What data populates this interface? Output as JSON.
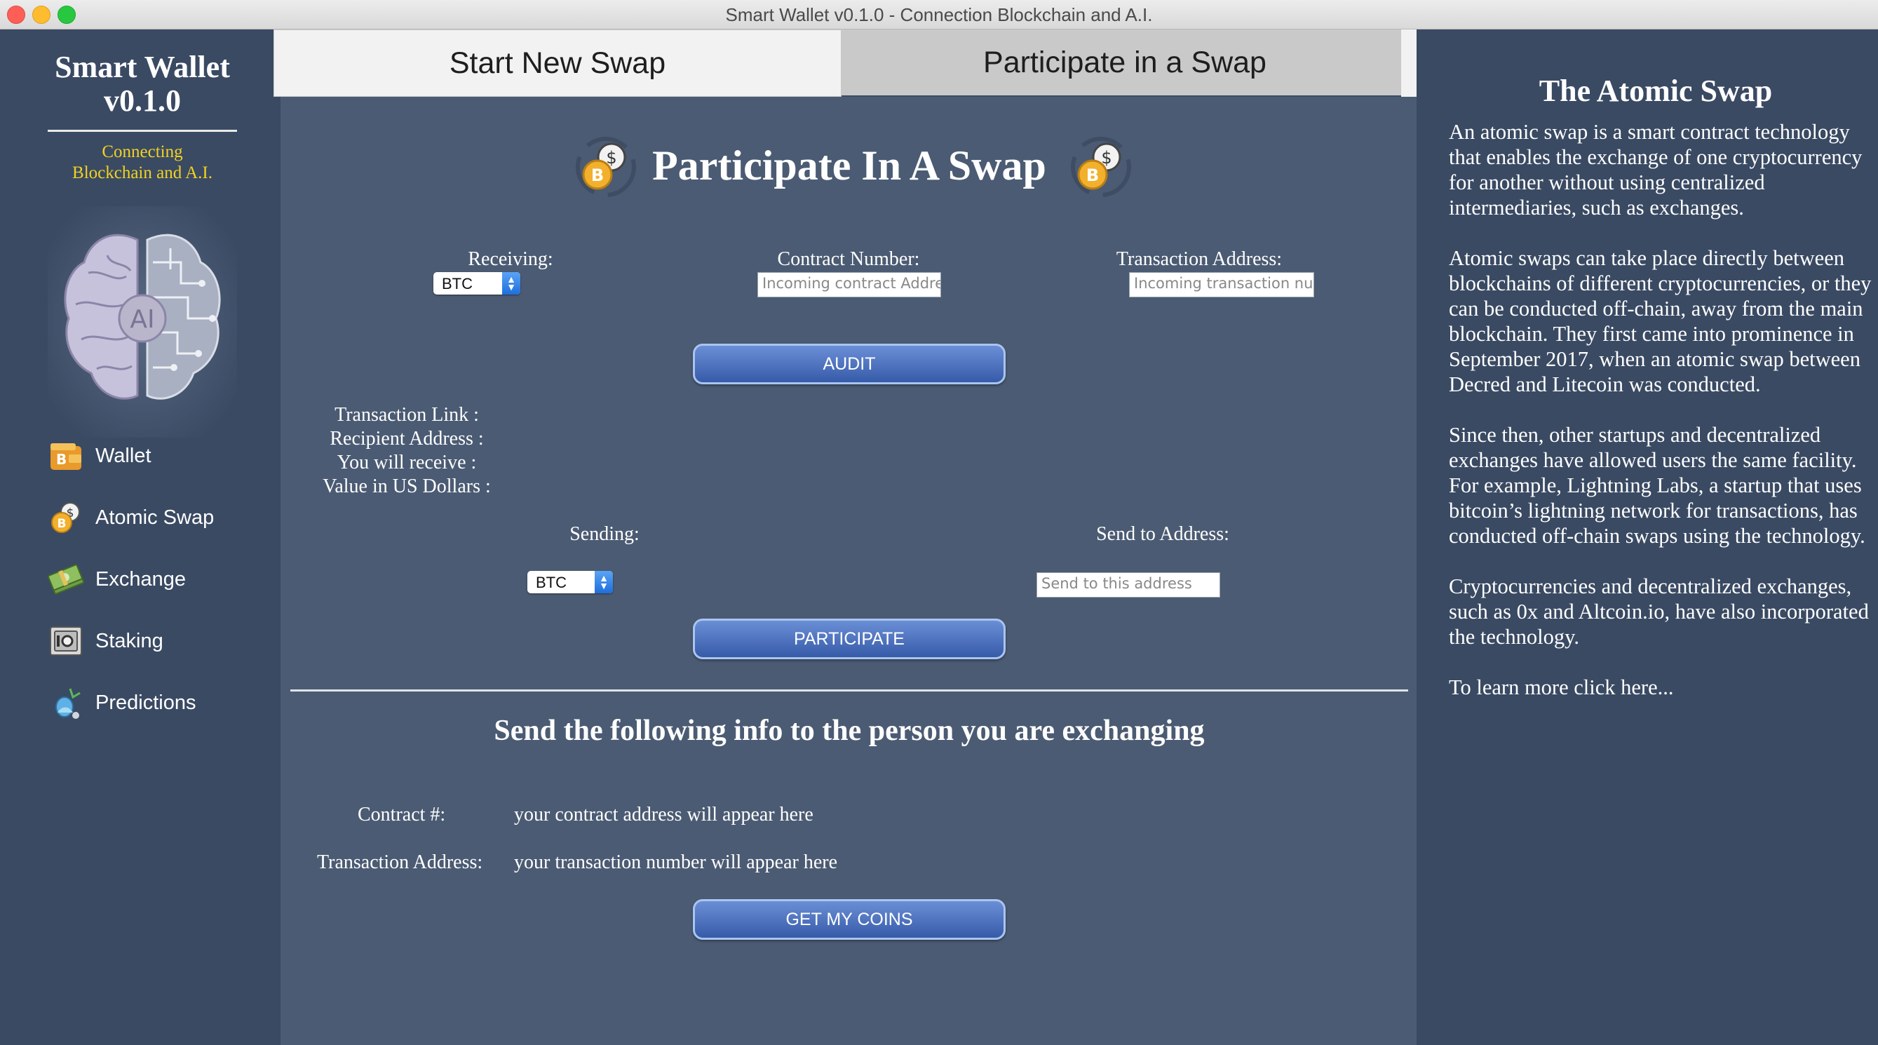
{
  "window": {
    "title": "Smart Wallet v0.1.0 - Connection Blockchain and A.I."
  },
  "sidebar": {
    "app_title_line1": "Smart Wallet",
    "app_title_line2": "v0.1.0",
    "tagline_line1": "Connecting",
    "tagline_line2": "Blockchain and A.I.",
    "logo_text": "AI",
    "items": [
      {
        "label": "Wallet",
        "icon": "wallet-icon"
      },
      {
        "label": "Atomic Swap",
        "icon": "atomic-swap-icon"
      },
      {
        "label": "Exchange",
        "icon": "exchange-icon"
      },
      {
        "label": "Staking",
        "icon": "safe-icon"
      },
      {
        "label": "Predictions",
        "icon": "predictions-icon"
      }
    ]
  },
  "tabs": [
    {
      "label": "Start New Swap"
    },
    {
      "label": "Participate in a Swap",
      "selected": true
    }
  ],
  "main": {
    "heading": "Participate In A Swap",
    "receiving_label": "Receiving:",
    "receiving_value": "BTC",
    "contract_number_label": "Contract Number:",
    "contract_number_placeholder": "Incoming contract Address",
    "transaction_address_label": "Transaction Address:",
    "transaction_address_placeholder": "Incoming transaction number",
    "audit_button": "AUDIT",
    "info": {
      "transaction_link": "Transaction Link :",
      "recipient_address": "Recipient Address :",
      "you_will_receive": "You will receive :",
      "value_usd": "Value in US Dollars :"
    },
    "sending_label": "Sending:",
    "sending_value": "BTC",
    "send_to_label": "Send to Address:",
    "send_to_placeholder": "Send to this address",
    "participate_button": "PARTICIPATE",
    "subheading": "Send the following info to the person you are exchanging",
    "contract_row_label": "Contract #:",
    "contract_row_value": "your contract address will appear here",
    "tx_row_label": "Transaction Address:",
    "tx_row_value": "your transaction number will appear here",
    "get_coins_button": "GET MY COINS"
  },
  "right_panel": {
    "title": "The Atomic Swap",
    "paragraphs": [
      "An atomic swap is a smart contract technology that enables the exchange of one cryptocurrency for another without using centralized intermediaries, such as exchanges.",
      "Atomic swaps can take place directly between blockchains of different cryptocurrencies, or they can be conducted off-chain, away from the main blockchain. They first came into prominence in September 2017, when an atomic swap between Decred and Litecoin was conducted.",
      "Since then, other startups and decentralized exchanges have allowed users the same facility. For example, Lightning Labs, a startup that uses bitcoin’s lightning network for transactions, has conducted off-chain swaps using the technology.",
      "Cryptocurrencies and decentralized exchanges, such as 0x and Altcoin.io, have also incorporated the technology."
    ],
    "link_text": "To learn more click here..."
  },
  "colors": {
    "sidebar_bg": "#3a4a63",
    "main_bg": "#4b5b73",
    "tagline": "#f2d21f",
    "button": "#4a6fc0"
  }
}
